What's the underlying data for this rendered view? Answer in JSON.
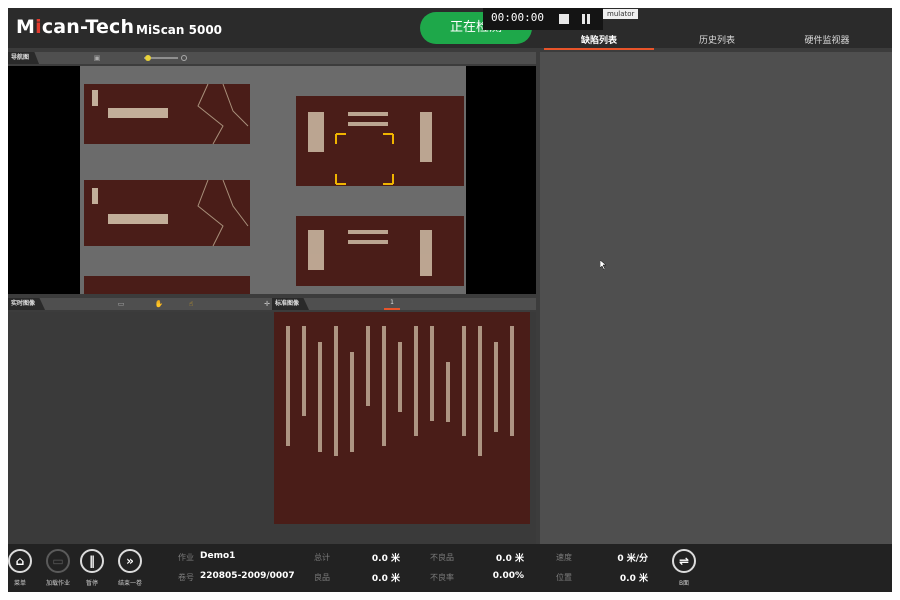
{
  "header": {
    "brand_prefix": "M",
    "brand_i": "i",
    "brand_suffix": "can-Tech",
    "model": "MiScan 5000",
    "status_text": "正在检测"
  },
  "recorder": {
    "timer": "00:00:00",
    "label": "mulator"
  },
  "tabs": [
    "缺陷列表",
    "历史列表",
    "硬件监视器"
  ],
  "active_tab": 0,
  "panels": {
    "nav_title": "导航图",
    "realtime_title": "实时图像",
    "standard_title": "标准图像",
    "standard_counter": "1"
  },
  "tools": {
    "save_icon": "save-icon",
    "zoom_slider": "zoom-slider",
    "hand_icon": "hand-icon",
    "pointer_icon": "pointer-icon",
    "crosshair_icon": "crosshair-icon"
  },
  "bottom": {
    "buttons": [
      {
        "label": "菜单",
        "icon": "home-icon"
      },
      {
        "label": "加载作业",
        "icon": "folder-icon"
      },
      {
        "label": "暂停",
        "icon": "pause-icon"
      },
      {
        "label": "结束一卷",
        "icon": "end-roll-icon"
      },
      {
        "label": "B面",
        "icon": "side-b-icon"
      }
    ],
    "job_label": "作业",
    "job_value": "Demo1",
    "roll_label": "卷号",
    "roll_value": "220805-2009/0007",
    "total_label": "总计",
    "total_value": "0.0 米",
    "good_label": "良品",
    "good_value": "0.0 米",
    "defect_label": "不良品",
    "defect_value": "0.0 米",
    "defect_rate_label": "不良率",
    "defect_rate_value": "0.00%",
    "speed_label": "速度",
    "speed_value": "0 米/分",
    "position_label": "位置",
    "position_value": "0.0 米"
  },
  "colors": {
    "accent": "#e8542a",
    "status_green": "#1ea84a",
    "brand_red": "#e23a2e",
    "focus_box": "#f0b400"
  }
}
